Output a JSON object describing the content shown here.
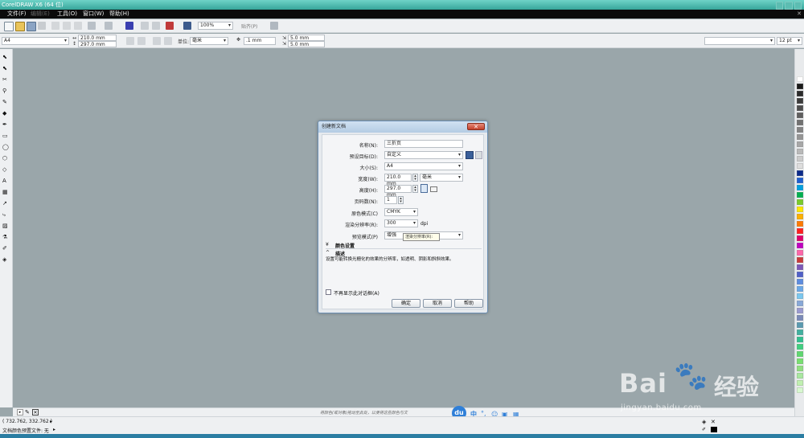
{
  "window": {
    "title": "CorelDRAW X6 (64 位)"
  },
  "menu": {
    "items": [
      {
        "label": "文件(F)",
        "dim": false
      },
      {
        "label": "编辑(E)",
        "dim": true
      },
      {
        "label": "工具(O)",
        "dim": false
      },
      {
        "label": "窗口(W)",
        "dim": false
      },
      {
        "label": "帮助(H)",
        "dim": false
      }
    ]
  },
  "toolbar": {
    "zoom": "100%",
    "snap": "贴齐(P)"
  },
  "propbar": {
    "page_size": "A4",
    "width": "210.0 mm",
    "height": "297.0 mm",
    "units_label": "单位:",
    "units": "毫米",
    "nudge": ".1 mm",
    "dup_x": "5.0 mm",
    "dup_y": "5.0 mm",
    "font_size": "12 pt"
  },
  "dialog": {
    "title": "创建新文档",
    "close": "✕",
    "fields": {
      "name": {
        "label": "名称(N):",
        "value": "三折页"
      },
      "preset": {
        "label": "预设目标(D):",
        "value": "自定义"
      },
      "size": {
        "label": "大小(S):",
        "value": "A4"
      },
      "width": {
        "label": "宽度(W):",
        "value": "210.0 mm",
        "unit": "毫米"
      },
      "height": {
        "label": "高度(H):",
        "value": "297.0 mm"
      },
      "pages": {
        "label": "页码数(N):",
        "value": "1"
      },
      "color_mode": {
        "label": "原色模式(C)",
        "value": "CMYK"
      },
      "resolution": {
        "label": "渲染分辨率(R):",
        "value": "300",
        "unit": "dpi"
      },
      "preview": {
        "label": "预览模式(P)",
        "value": "增强"
      }
    },
    "tooltip": "渲染分辨率(R):",
    "color_settings": "颜色设置",
    "description_title": "描述",
    "description": "设置可能转换光栅化的效果的分辨率，如透明、阴影和斜斜效果。",
    "dont_show": "不再显示此对话框(A)",
    "buttons": {
      "ok": "确定",
      "cancel": "取消",
      "help": "帮助"
    }
  },
  "status": {
    "coords": "( 732.762, 332.762 )",
    "doc_profile": "文档颜色预置文件: 无",
    "hint": "将颜色(或对象)拖动至此处，以便将这些颜色与文"
  },
  "ime": {
    "logo": "du",
    "lang": "中"
  },
  "watermark": {
    "brand": "Bai",
    "brand_cn": "经验",
    "url": "jingyan.baidu.com"
  },
  "palette": {
    "colors": [
      "#ffffff",
      "#1a1a1a",
      "#2a2a2a",
      "#3b3b3b",
      "#4d4d4d",
      "#5f5f5f",
      "#717171",
      "#838383",
      "#959595",
      "#a7a7a7",
      "#b9b9b9",
      "#cbcbcb",
      "#dddddd",
      "#0b2a8a",
      "#1f5fd0",
      "#00a0e0",
      "#00b050",
      "#7acc2a",
      "#ffe800",
      "#ffb000",
      "#ff7a00",
      "#ff1f1f",
      "#e0006a",
      "#c000c0",
      "#ff66aa",
      "#c83a3a",
      "#7c58b8",
      "#5060c8",
      "#5c8ce0",
      "#6aa8e8",
      "#7ac8f0",
      "#88a8d8",
      "#9a9ad0",
      "#7a8ab8",
      "#5a9ab0",
      "#40b0a0",
      "#30c090",
      "#40d080",
      "#60d870",
      "#78e070",
      "#90e080",
      "#a8e8a0",
      "#c0f0b0",
      "#d8f8d0"
    ]
  }
}
